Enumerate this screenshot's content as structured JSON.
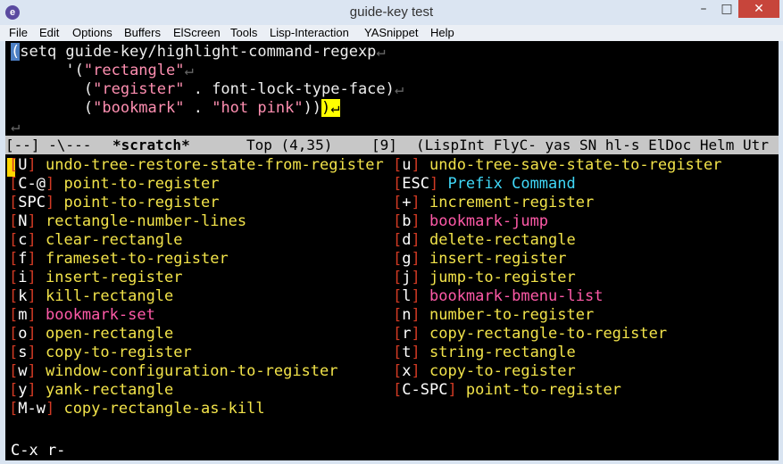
{
  "window": {
    "title": "guide-key test",
    "app_icon_glyph": "e",
    "min_glyph": "–",
    "max_glyph": "□",
    "close_glyph": "✕"
  },
  "menubar": [
    "File",
    "Edit",
    "Options",
    "Buffers",
    "ElScreen",
    "Tools",
    "Lisp-Interaction",
    "YASnippet",
    "Help"
  ],
  "buffer": {
    "line1": {
      "cursor_char": "(",
      "text": "setq guide-key/highlight-command-regexp",
      "ret": "↵"
    },
    "line2": {
      "prefix": "      '(",
      "str": "\"rectangle\"",
      "ret": "↵"
    },
    "line3": {
      "prefix": "        (",
      "str": "\"register\"",
      "rest": " . font-lock-type-face)",
      "ret": "↵"
    },
    "line4": {
      "prefix": "        (",
      "str1": "\"bookmark\"",
      "sep": " . ",
      "str2": "\"hot pink\"",
      "close": "))",
      "hl_char": ")",
      "ret": "↵"
    },
    "line5": {
      "ret": "↵"
    }
  },
  "modeline": {
    "status": "[--] -\\---",
    "buffer_name": "*scratch*",
    "position": "Top (4,35)",
    "level": "[9]",
    "modes": "(LispInt FlyC- yas SN hl-s ElDoc Helm Utr"
  },
  "guide_key": {
    "left": [
      {
        "key": "U",
        "cmd": "undo-tree-restore-state-from-register",
        "color": "yellow"
      },
      {
        "key": "C-@",
        "cmd": "point-to-register",
        "color": "yellow"
      },
      {
        "key": "SPC",
        "cmd": "point-to-register",
        "color": "yellow"
      },
      {
        "key": "N",
        "cmd": "rectangle-number-lines",
        "color": "yellow"
      },
      {
        "key": "c",
        "cmd": "clear-rectangle",
        "color": "yellow"
      },
      {
        "key": "f",
        "cmd": "frameset-to-register",
        "color": "yellow"
      },
      {
        "key": "i",
        "cmd": "insert-register",
        "color": "yellow"
      },
      {
        "key": "k",
        "cmd": "kill-rectangle",
        "color": "yellow"
      },
      {
        "key": "m",
        "cmd": "bookmark-set",
        "color": "pink"
      },
      {
        "key": "o",
        "cmd": "open-rectangle",
        "color": "yellow"
      },
      {
        "key": "s",
        "cmd": "copy-to-register",
        "color": "yellow"
      },
      {
        "key": "w",
        "cmd": "window-configuration-to-register",
        "color": "yellow"
      },
      {
        "key": "y",
        "cmd": "yank-rectangle",
        "color": "yellow"
      },
      {
        "key": "M-w",
        "cmd": "copy-rectangle-as-kill",
        "color": "yellow"
      }
    ],
    "right": [
      {
        "key": "u",
        "cmd": "undo-tree-save-state-to-register",
        "color": "yellow"
      },
      {
        "key": "ESC",
        "cmd": "Prefix Command",
        "color": "cyan"
      },
      {
        "key": "+",
        "cmd": "increment-register",
        "color": "yellow"
      },
      {
        "key": "b",
        "cmd": "bookmark-jump",
        "color": "pink"
      },
      {
        "key": "d",
        "cmd": "delete-rectangle",
        "color": "yellow"
      },
      {
        "key": "g",
        "cmd": "insert-register",
        "color": "yellow"
      },
      {
        "key": "j",
        "cmd": "jump-to-register",
        "color": "yellow"
      },
      {
        "key": "l",
        "cmd": "bookmark-bmenu-list",
        "color": "pink"
      },
      {
        "key": "n",
        "cmd": "number-to-register",
        "color": "yellow"
      },
      {
        "key": "r",
        "cmd": "copy-rectangle-to-register",
        "color": "yellow"
      },
      {
        "key": "t",
        "cmd": "string-rectangle",
        "color": "yellow"
      },
      {
        "key": "x",
        "cmd": "copy-to-register",
        "color": "yellow"
      },
      {
        "key": "C-SPC",
        "cmd": "point-to-register",
        "color": "yellow"
      }
    ]
  },
  "minibuffer": {
    "text": "C-x r-"
  },
  "colors": {
    "bracket": "#d23a24",
    "yellow": "#f2e34a",
    "pink": "#ff5aa8",
    "cyan": "#40d8f8"
  }
}
